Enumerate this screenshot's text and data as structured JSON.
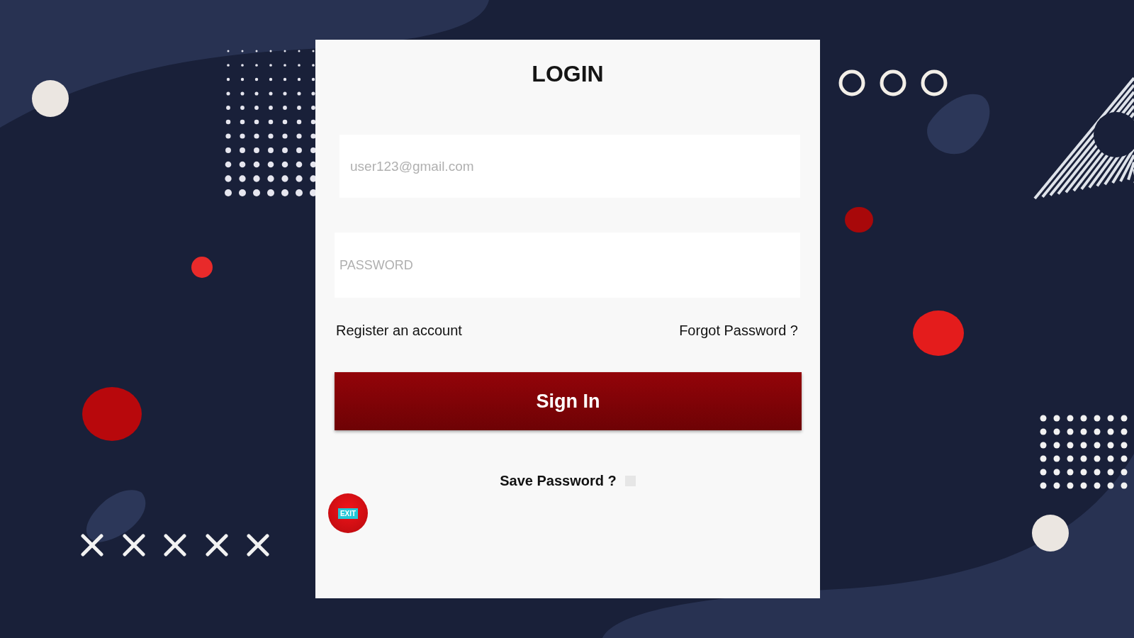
{
  "login_card": {
    "title": "LOGIN",
    "email_field": {
      "placeholder": "user123@gmail.com"
    },
    "password_field": {
      "placeholder": "PASSWORD"
    },
    "register_link": "Register an account",
    "forgot_link": "Forgot Password ?",
    "sign_in_button": "Sign In",
    "save_password": {
      "label": "Save Password ?",
      "checked": false
    },
    "exit_button": "EXIT"
  }
}
